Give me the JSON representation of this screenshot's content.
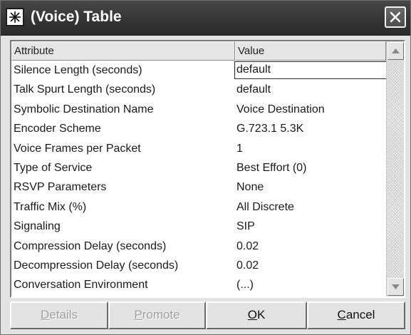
{
  "window": {
    "title": "(Voice) Table",
    "app_icon": "star-burst-icon",
    "close_icon": "close-icon"
  },
  "table": {
    "columns": {
      "attribute": "Attribute",
      "value": "Value"
    },
    "rows": [
      {
        "attribute": "Silence Length (seconds)",
        "value": "default",
        "editing": true
      },
      {
        "attribute": "Talk Spurt Length (seconds)",
        "value": "default"
      },
      {
        "attribute": "Symbolic Destination Name",
        "value": "Voice Destination"
      },
      {
        "attribute": "Encoder Scheme",
        "value": "G.723.1 5.3K"
      },
      {
        "attribute": "Voice Frames per Packet",
        "value": "1"
      },
      {
        "attribute": "Type of Service",
        "value": "Best Effort (0)"
      },
      {
        "attribute": "RSVP Parameters",
        "value": "None"
      },
      {
        "attribute": "Traffic Mix (%)",
        "value": "All Discrete"
      },
      {
        "attribute": "Signaling",
        "value": "SIP"
      },
      {
        "attribute": "Compression Delay (seconds)",
        "value": "0.02"
      },
      {
        "attribute": "Decompression Delay (seconds)",
        "value": "0.02"
      },
      {
        "attribute": "Conversation Environment",
        "value": "(...)"
      }
    ]
  },
  "buttons": {
    "details": {
      "first": "D",
      "rest": "etails",
      "enabled": false
    },
    "promote": {
      "first": "P",
      "rest": "romote",
      "enabled": false
    },
    "ok": {
      "first": "O",
      "rest": "K",
      "enabled": true
    },
    "cancel": {
      "first": "C",
      "rest": "ancel",
      "enabled": true
    }
  },
  "colors": {
    "titlebar": "#353535",
    "dialog_bg": "#e3e3e3",
    "table_bg": "#ffffff",
    "disabled_text": "#a0a0a0"
  }
}
